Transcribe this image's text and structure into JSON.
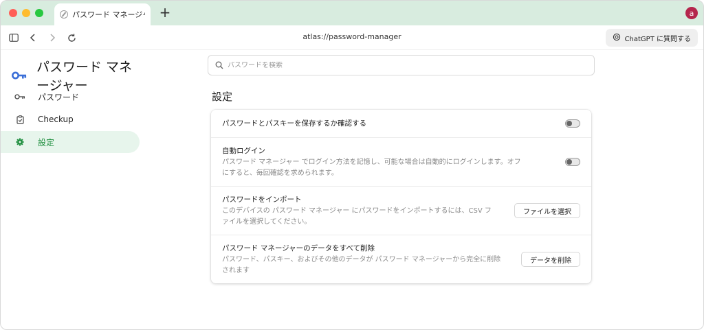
{
  "browser": {
    "tab_title": "パスワード マネージャー",
    "new_tab_symbol": "+",
    "avatar_initial": "a",
    "address": "atlas://password-manager",
    "chatgpt_button": "ChatGPT に質問する"
  },
  "sidebar": {
    "title": "パスワード マネージャー",
    "items": [
      {
        "label": "パスワード",
        "icon": "key-icon"
      },
      {
        "label": "Checkup",
        "icon": "clipboard-check-icon"
      },
      {
        "label": "設定",
        "icon": "gear-icon",
        "active": true
      }
    ]
  },
  "main": {
    "search_placeholder": "パスワードを検索",
    "section_title": "設定",
    "rows": [
      {
        "title": "パスワードとパスキーを保存するか確認する",
        "desc": "",
        "control": "toggle"
      },
      {
        "title": "自動ログイン",
        "desc": "パスワード マネージャー でログイン方法を記憶し、可能な場合は自動的にログインします。オフにすると、毎回確認を求められます。",
        "control": "toggle"
      },
      {
        "title": "パスワードをインポート",
        "desc": "このデバイスの パスワード マネージャー にパスワードをインポートするには、CSV ファイルを選択してください。",
        "control": "button",
        "button_label": "ファイルを選択"
      },
      {
        "title": "パスワード マネージャーのデータをすべて削除",
        "desc": "パスワード、パスキー、およびその他のデータが パスワード マネージャーから完全に削除されます",
        "control": "button",
        "button_label": "データを削除"
      }
    ]
  },
  "colors": {
    "accent": "#1e8e3e",
    "brand_key": "#3b6fd8",
    "titlebar": "#d8ecdf"
  }
}
